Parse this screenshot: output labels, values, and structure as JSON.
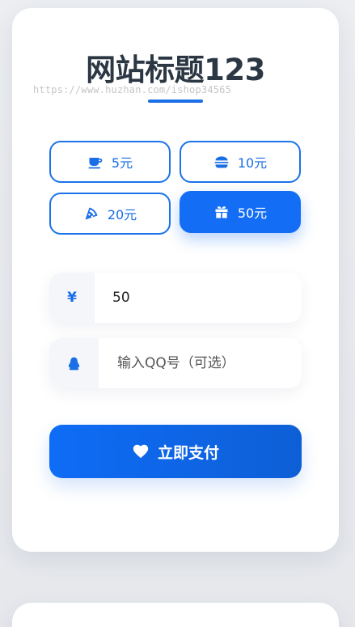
{
  "header": {
    "title": "网站标题123",
    "watermark": "https://www.huzhan.com/ishop34565"
  },
  "amounts": [
    {
      "label": "5元",
      "icon": "coffee-cup-icon",
      "selected": false
    },
    {
      "label": "10元",
      "icon": "burger-icon",
      "selected": false
    },
    {
      "label": "20元",
      "icon": "pizza-slice-icon",
      "selected": false
    },
    {
      "label": "50元",
      "icon": "gift-icon",
      "selected": true
    }
  ],
  "form": {
    "amount_symbol": "¥",
    "amount_value": "50",
    "qq_placeholder": "输入QQ号（可选）",
    "qq_icon": "qq-penguin-icon"
  },
  "pay": {
    "label": "立即支付",
    "icon": "heart-icon"
  },
  "colors": {
    "accent": "#146ef5",
    "title": "#2c3744",
    "background": "#e9eaed"
  }
}
